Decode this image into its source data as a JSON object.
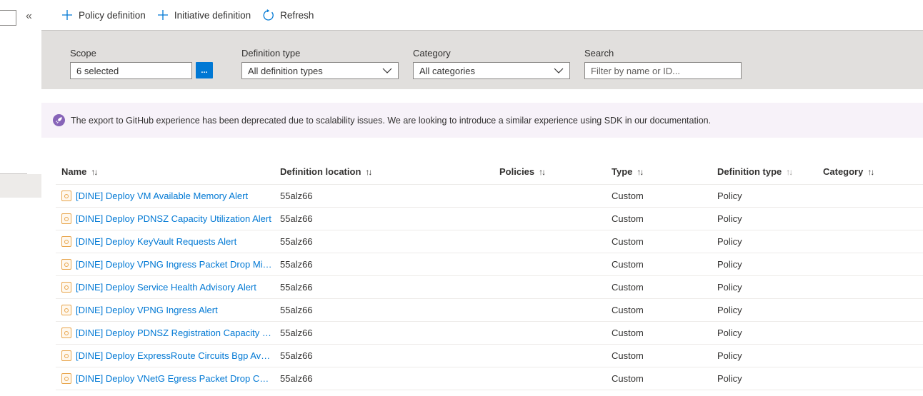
{
  "toolbar": {
    "policy_definition": "Policy definition",
    "initiative_definition": "Initiative definition",
    "refresh": "Refresh"
  },
  "nav": {
    "collapse_glyph": "«"
  },
  "filters": {
    "scope": {
      "label": "Scope",
      "value": "6 selected",
      "button": "..."
    },
    "definition_type": {
      "label": "Definition type",
      "value": "All definition types"
    },
    "category": {
      "label": "Category",
      "value": "All categories"
    },
    "search": {
      "label": "Search",
      "placeholder": "Filter by name or ID..."
    }
  },
  "banner": {
    "text": "The export to GitHub experience has been deprecated due to scalability issues. We are looking to introduce a similar experience using SDK in our documentation.",
    "icon": "rocket-icon",
    "color": "#8764b8"
  },
  "table": {
    "columns": [
      "Name",
      "Definition location",
      "Policies",
      "Type",
      "Definition type",
      "Category"
    ],
    "sort_glyph": "↑↓",
    "rows": [
      {
        "name": "[DINE] Deploy VM Available Memory Alert",
        "location": "55alz66",
        "policies": "",
        "type": "Custom",
        "definition_type": "Policy",
        "category": ""
      },
      {
        "name": "[DINE] Deploy PDNSZ Capacity Utilization Alert",
        "location": "55alz66",
        "policies": "",
        "type": "Custom",
        "definition_type": "Policy",
        "category": ""
      },
      {
        "name": "[DINE] Deploy KeyVault Requests Alert",
        "location": "55alz66",
        "policies": "",
        "type": "Custom",
        "definition_type": "Policy",
        "category": ""
      },
      {
        "name": "[DINE] Deploy VPNG Ingress Packet Drop Mis…",
        "location": "55alz66",
        "policies": "",
        "type": "Custom",
        "definition_type": "Policy",
        "category": ""
      },
      {
        "name": "[DINE] Deploy Service Health Advisory Alert",
        "location": "55alz66",
        "policies": "",
        "type": "Custom",
        "definition_type": "Policy",
        "category": ""
      },
      {
        "name": "[DINE] Deploy VPNG Ingress Alert",
        "location": "55alz66",
        "policies": "",
        "type": "Custom",
        "definition_type": "Policy",
        "category": ""
      },
      {
        "name": "[DINE] Deploy PDNSZ Registration Capacity Ut…",
        "location": "55alz66",
        "policies": "",
        "type": "Custom",
        "definition_type": "Policy",
        "category": ""
      },
      {
        "name": "[DINE] Deploy ExpressRoute Circuits Bgp Avail…",
        "location": "55alz66",
        "policies": "",
        "type": "Custom",
        "definition_type": "Policy",
        "category": ""
      },
      {
        "name": "[DINE] Deploy VNetG Egress Packet Drop Cou…",
        "location": "55alz66",
        "policies": "",
        "type": "Custom",
        "definition_type": "Policy",
        "category": ""
      }
    ]
  },
  "colors": {
    "accent": "#0078d4",
    "link": "#0078d4",
    "filter_bg": "#e1dfdd",
    "banner_bg": "#f7f2f9",
    "policy_icon": "#e8a54c"
  }
}
